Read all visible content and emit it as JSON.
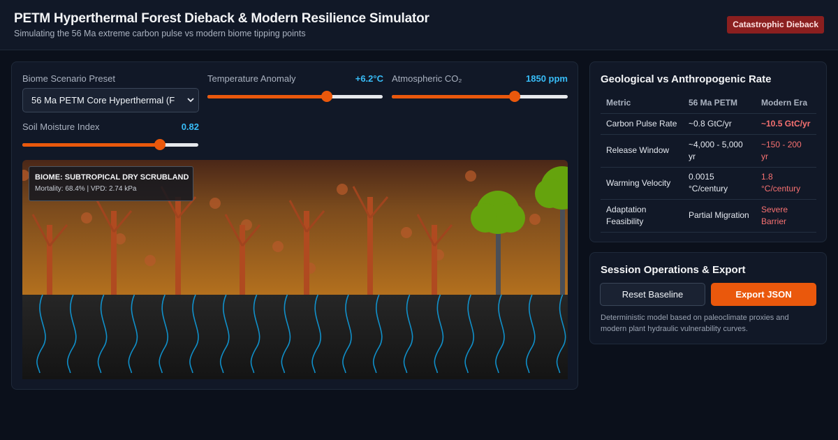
{
  "header": {
    "title": "PETM Hyperthermal Forest Dieback & Modern Resilience Simulator",
    "subtitle": "Simulating the 56 Ma extreme carbon pulse vs modern biome tipping points",
    "status_badge": "Catastrophic Dieback",
    "status_color": "#8b1f1f"
  },
  "controls": {
    "preset": {
      "label": "Biome Scenario Preset",
      "selected": "56 Ma PETM Core Hyperthermal (F"
    },
    "temperature": {
      "label": "Temperature Anomaly",
      "value_text": "+6.2°C",
      "fraction": 0.68
    },
    "co2": {
      "label": "Atmospheric CO₂",
      "value_text": "1850 ppm",
      "fraction": 0.7
    },
    "moisture": {
      "label": "Soil Moisture Index",
      "value_text": "0.82",
      "fraction": 0.78
    },
    "accent": "#ea580c",
    "value_color": "#38bdf8"
  },
  "scene": {
    "biome_label": "BIOME: SUBTROPICAL DRY SCRUBLAND",
    "stats": "Mortality: 68.4% | VPD: 2.74 kPa"
  },
  "comparison": {
    "title": "Geological vs Anthropogenic Rate",
    "headers": [
      "Metric",
      "56 Ma PETM",
      "Modern Era"
    ],
    "rows": [
      {
        "metric": "Carbon Pulse Rate",
        "petm": "~0.8 GtC/yr",
        "modern": "~10.5 GtC/yr"
      },
      {
        "metric": "Release Window",
        "petm": "~4,000 - 5,000 yr",
        "modern": "~150 - 200 yr"
      },
      {
        "metric": "Warming Velocity",
        "petm": "0.0015 °C/century",
        "modern": "1.8 °C/century"
      },
      {
        "metric": "Adaptation Feasibility",
        "petm": "Partial Migration",
        "modern": "Severe Barrier"
      }
    ],
    "modern_color": "#f87171"
  },
  "session": {
    "title": "Session Operations & Export",
    "reset_label": "Reset Baseline",
    "export_label": "Export JSON",
    "footnote": "Deterministic model based on paleoclimate proxies and modern plant hydraulic vulnerability curves."
  }
}
